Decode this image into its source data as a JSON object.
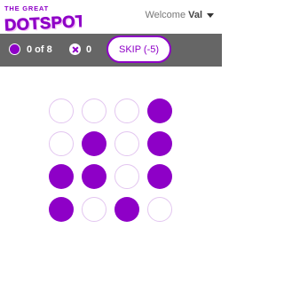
{
  "header": {
    "logo_line1": "THE GREAT",
    "logo_line2": "DOTSPOT",
    "welcome_prefix": "Welcome",
    "user_name": "Val"
  },
  "status": {
    "score": "0 of 8",
    "misses": "0",
    "skip_label": "SKIP (-5)"
  },
  "colors": {
    "accent": "#8e00c7",
    "bar": "#666666",
    "empty_border": "#e3c6f0"
  },
  "grid": {
    "rows": 4,
    "cols": 4,
    "cells": [
      [
        0,
        0,
        0,
        1
      ],
      [
        0,
        1,
        0,
        1
      ],
      [
        1,
        1,
        0,
        1
      ],
      [
        1,
        0,
        1,
        0
      ]
    ]
  }
}
